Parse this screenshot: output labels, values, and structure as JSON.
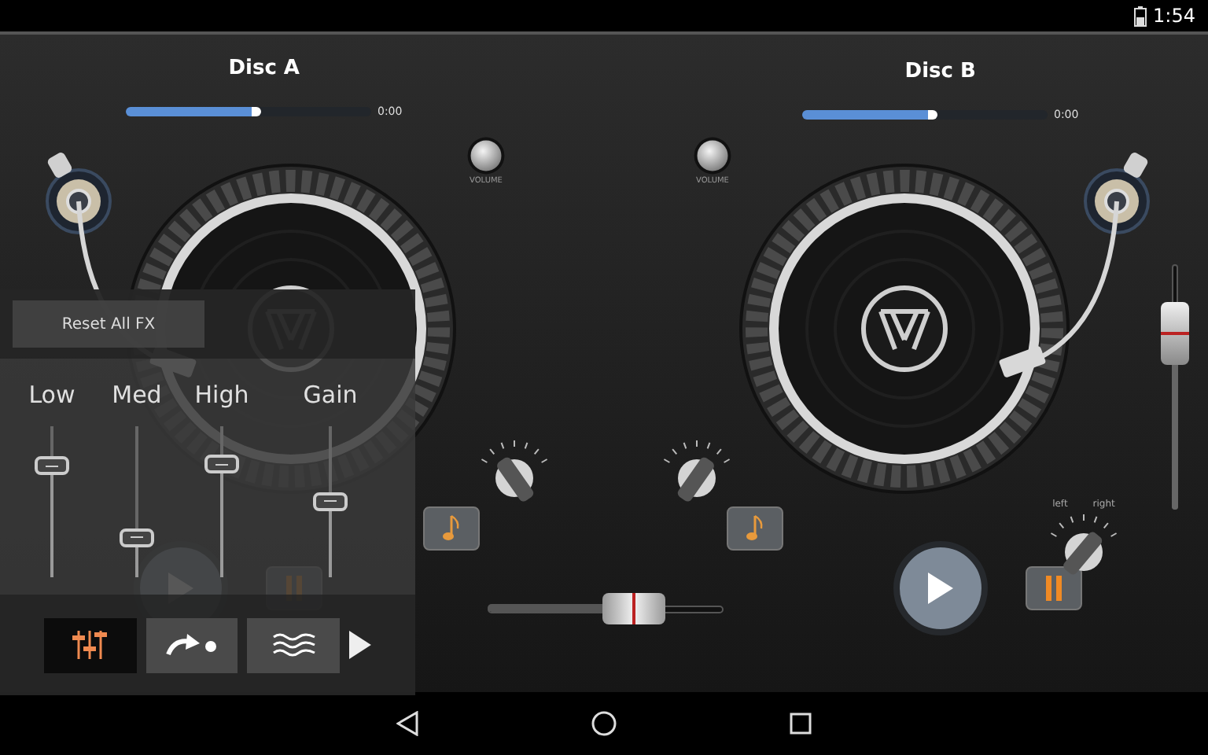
{
  "status_bar": {
    "time": "1:54"
  },
  "decks": [
    {
      "title": "Disc A",
      "progress": {
        "level": 0.55
      },
      "time": "0:00",
      "volume_label": "VOLUME",
      "playing": false
    },
    {
      "title": "Disc B",
      "progress": {
        "level": 0.55
      },
      "time": "0:00",
      "volume_label": "VOLUME",
      "playing": false
    }
  ],
  "pitch_slider": {
    "level": 0.72
  },
  "crossfader": {
    "level": 0.62
  },
  "pan_knob": {
    "left_label": "left",
    "right_label": "right"
  },
  "fx_panel": {
    "reset_button": "Reset All FX",
    "eq_sliders": [
      {
        "label": "Low",
        "level": 0.73
      },
      {
        "label": "Med",
        "level": 0.26
      },
      {
        "label": "High",
        "level": 0.74
      },
      {
        "label": "Gain",
        "level": 0.5
      }
    ],
    "tabs": [
      {
        "kind": "equalizer",
        "selected": true
      },
      {
        "kind": "loop",
        "selected": false
      },
      {
        "kind": "wave",
        "selected": false
      }
    ]
  }
}
